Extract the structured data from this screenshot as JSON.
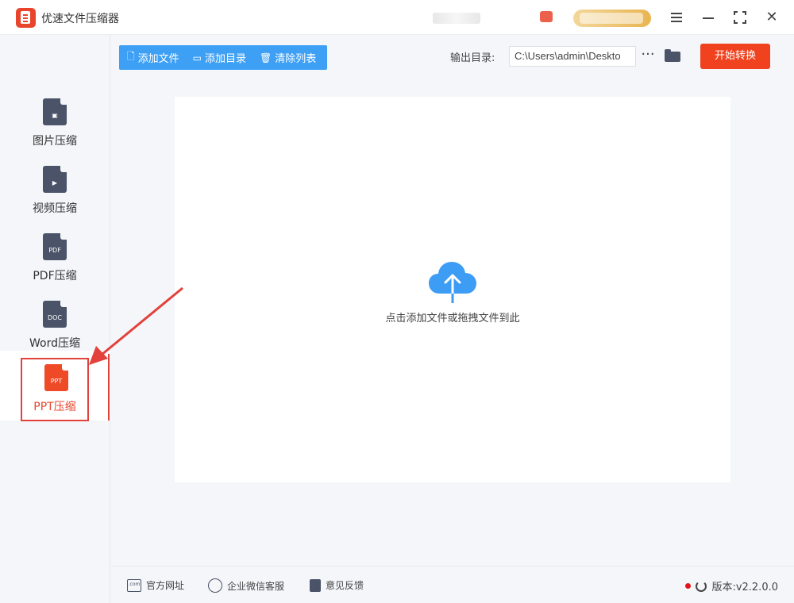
{
  "app": {
    "title": "优速文件压缩器"
  },
  "sidebar": {
    "items": [
      {
        "label": "图片压缩",
        "icon": "image-file-icon",
        "glyph": "▣",
        "active": false
      },
      {
        "label": "视频压缩",
        "icon": "video-file-icon",
        "glyph": "▶",
        "active": false
      },
      {
        "label": "PDF压缩",
        "icon": "pdf-file-icon",
        "glyph": "PDF",
        "active": false
      },
      {
        "label": "Word压缩",
        "icon": "doc-file-icon",
        "glyph": "DOC",
        "active": false
      },
      {
        "label": "PPT压缩",
        "icon": "ppt-file-icon",
        "glyph": "PPT",
        "active": true
      }
    ]
  },
  "toolbar": {
    "add_file": "添加文件",
    "add_folder": "添加目录",
    "clear_list": "清除列表",
    "output_label": "输出目录:",
    "output_path": "C:\\Users\\admin\\Deskto",
    "more": "···",
    "start": "开始转换"
  },
  "dropzone": {
    "hint": "点击添加文件或拖拽文件到此"
  },
  "footer": {
    "website": "官方网址",
    "wechat": "企业微信客服",
    "feedback": "意见反馈",
    "version": "版本:v2.2.0.0"
  },
  "colors": {
    "accent": "#3ea0f5",
    "primary": "#f0421e",
    "active": "#e3413b",
    "sidebar_icon": "#4a5368"
  }
}
